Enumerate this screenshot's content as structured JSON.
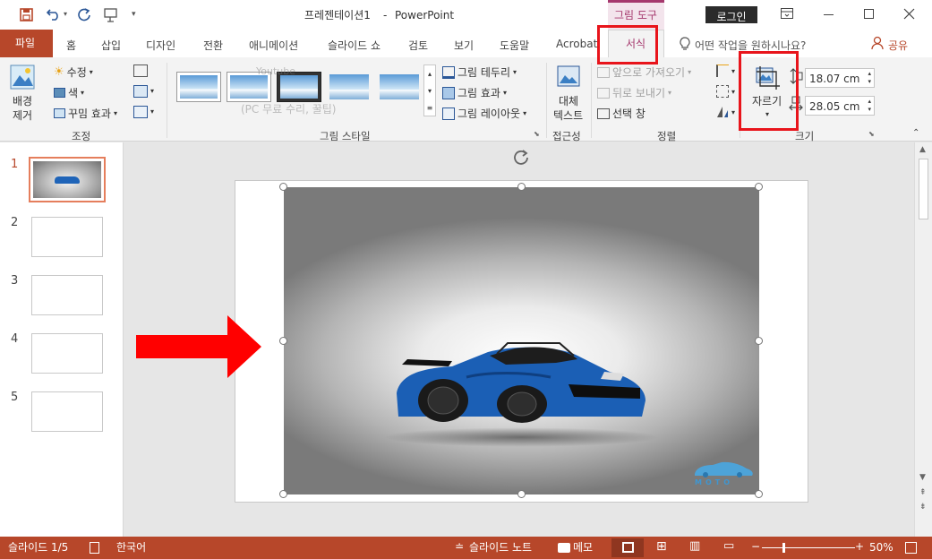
{
  "titlebar": {
    "doc_title": "프레젠테이션1",
    "app_sep": "-",
    "app_name": "PowerPoint",
    "context_group": "그림 도구",
    "login": "로그인"
  },
  "tabs": {
    "file": "파일",
    "items": [
      "홈",
      "삽입",
      "디자인",
      "전환",
      "애니메이션",
      "슬라이드 쇼",
      "검토",
      "보기",
      "도움말",
      "Acrobat"
    ],
    "active": "서식",
    "tell_me": "어떤 작업을 원하시나요?",
    "share": "공유"
  },
  "ribbon": {
    "remove_bg": [
      "배경",
      "제거"
    ],
    "adjust": {
      "correct": "수정",
      "color": "색",
      "artistic": "꾸밈 효과",
      "label": "조정"
    },
    "styles": {
      "border": "그림 테두리",
      "effects": "그림 효과",
      "layout": "그림 레이아웃",
      "label": "그림 스타일"
    },
    "access": {
      "alt_text": [
        "대체",
        "텍스트"
      ],
      "label": "접근성"
    },
    "arrange": {
      "bring_forward": "앞으로 가져오기",
      "send_backward": "뒤로 보내기",
      "selection_pane": "선택 창",
      "label": "정렬"
    },
    "size": {
      "crop": "자르기",
      "height": "18.07 cm",
      "width": "28.05 cm",
      "label": "크기"
    },
    "watermark": {
      "channel": "Youtube",
      "sub": "(PC 무료 수리, 꿀팁)"
    }
  },
  "slides": [
    "1",
    "2",
    "3",
    "4",
    "5"
  ],
  "image_caption": "MOTO",
  "status": {
    "slide_info": "슬라이드 1/5",
    "language": "한국어",
    "notes": "슬라이드 노트",
    "comments": "메모",
    "zoom": "50%"
  },
  "colors": {
    "accent": "#b7472a",
    "context": "#a5386d",
    "highlight": "#e8141b",
    "arrow": "#ff0000"
  }
}
